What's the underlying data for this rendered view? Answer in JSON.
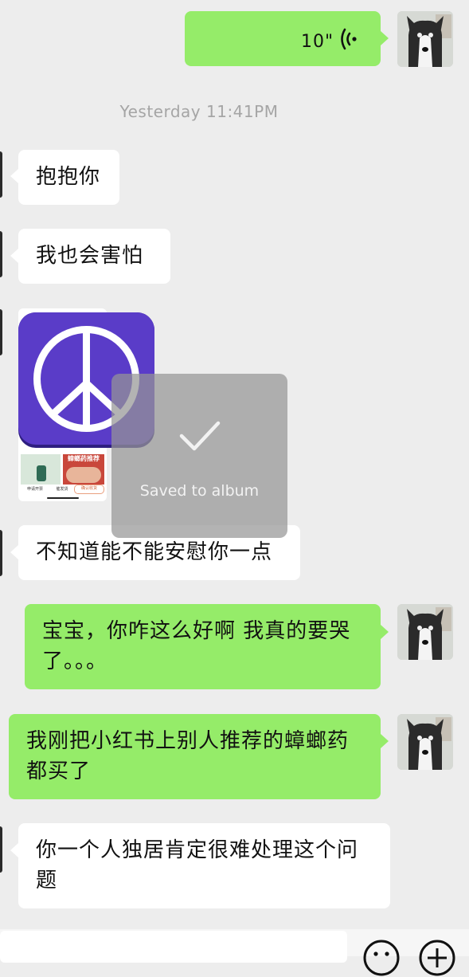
{
  "voice_message": {
    "duration": "10\""
  },
  "timestamp": "Yesterday 11:41PM",
  "messages": [
    {
      "side": "in",
      "text": "抱抱你"
    },
    {
      "side": "in",
      "text": "我也会害怕"
    },
    {
      "side": "in",
      "text": "不知道能不能安慰你一点"
    },
    {
      "side": "out",
      "text_line1": "宝宝，你咋这么好啊 我真的要哭",
      "text_line2": "了。。。"
    },
    {
      "side": "out",
      "text_line1": "我刚把小红书上别人推荐的蟑螂药",
      "text_line2": "都买了"
    },
    {
      "side": "in",
      "text_line1": "你一个人独居肯定很难处理这个问",
      "text_line2": "题"
    }
  ],
  "toast": {
    "text": "Saved to album",
    "icon": "checkmark-icon"
  },
  "shared_image": {
    "icon": "peace-sign-icon",
    "accent": "#5a3cc8",
    "thumb_red_text": "蟑螂药推荐",
    "thumb_caption_1": "申请开票",
    "thumb_caption_2": "催发货",
    "thumb_caption_3": "确认收货"
  },
  "input_bar": {
    "emoji_icon": "emoji-icon",
    "plus_icon": "plus-icon"
  },
  "colors": {
    "background": "#ededed",
    "outgoing_bubble": "#95ec69",
    "incoming_bubble": "#ffffff",
    "timestamp": "#a5a5a5"
  }
}
